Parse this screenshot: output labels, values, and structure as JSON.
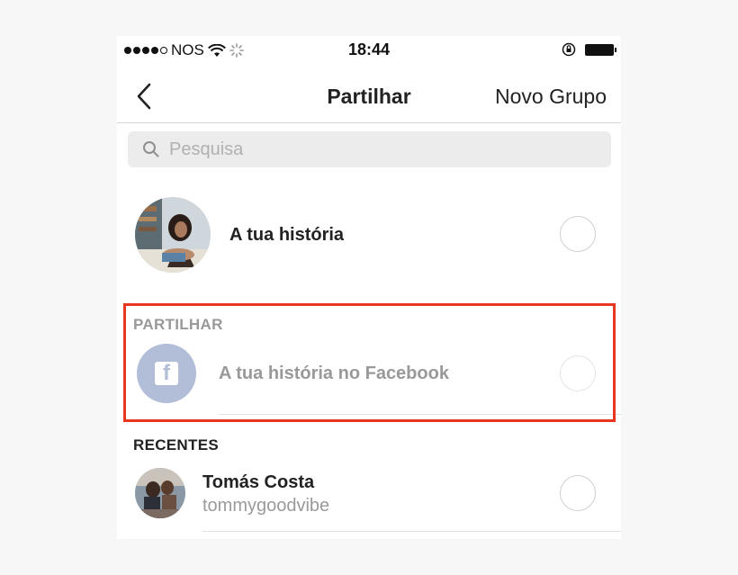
{
  "status_bar": {
    "carrier": "NOS",
    "time": "18:44"
  },
  "nav": {
    "title": "Partilhar",
    "right_action": "Novo Grupo"
  },
  "search": {
    "placeholder": "Pesquisa"
  },
  "story_row": {
    "label": "A tua história"
  },
  "share_section": {
    "header": "PARTILHAR",
    "facebook_label": "A tua história no Facebook"
  },
  "recent_section": {
    "header": "RECENTES",
    "contacts": [
      {
        "name": "Tomás Costa",
        "username": "tommygoodvibe"
      }
    ]
  },
  "colors": {
    "highlight": "#e8361f",
    "facebook_disabled": "#b2bdd8"
  },
  "icons": [
    "back-chevron-icon",
    "search-icon",
    "facebook-icon",
    "wifi-icon",
    "battery-icon",
    "rotation-lock-icon"
  ]
}
